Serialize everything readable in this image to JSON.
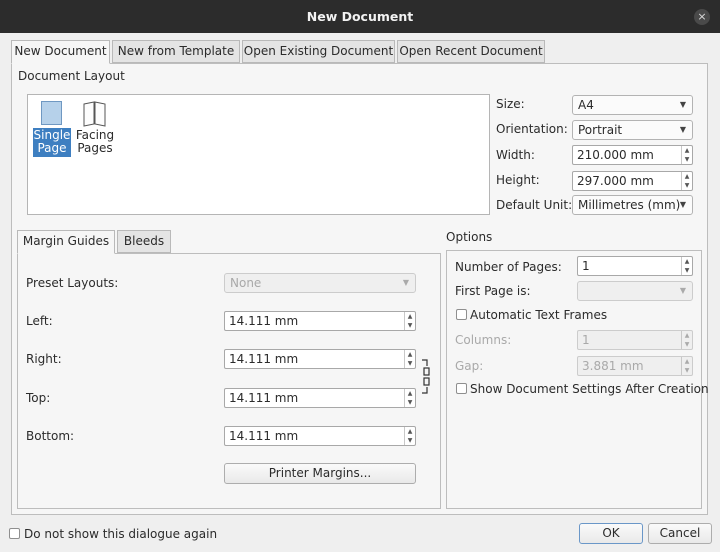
{
  "window": {
    "title": "New Document",
    "close_glyph": "×"
  },
  "tabs": [
    {
      "label": "New Document"
    },
    {
      "label": "New from Template"
    },
    {
      "label": "Open Existing Document"
    },
    {
      "label": "Open Recent Document"
    }
  ],
  "document_layout": {
    "title": "Document Layout",
    "layouts": [
      {
        "line1": "Single",
        "line2": "Page",
        "icon": "single-page-icon"
      },
      {
        "line1": "Facing",
        "line2": "Pages",
        "icon": "facing-pages-icon"
      }
    ],
    "size_label": "Size:",
    "size_value": "A4",
    "orientation_label": "Orientation:",
    "orientation_value": "Portrait",
    "width_label": "Width:",
    "width_value": "210.000 mm",
    "height_label": "Height:",
    "height_value": "297.000 mm",
    "unit_label": "Default Unit:",
    "unit_value": "Millimetres (mm)"
  },
  "margin_tabs": [
    {
      "label": "Margin Guides"
    },
    {
      "label": "Bleeds"
    }
  ],
  "margins": {
    "preset_label": "Preset Layouts:",
    "preset_value": "None",
    "left_label": "Left:",
    "left_value": "14.111 mm",
    "right_label": "Right:",
    "right_value": "14.111 mm",
    "top_label": "Top:",
    "top_value": "14.111 mm",
    "bottom_label": "Bottom:",
    "bottom_value": "14.111 mm",
    "printer_margins_label": "Printer Margins..."
  },
  "options": {
    "title": "Options",
    "pages_label": "Number of Pages:",
    "pages_value": "1",
    "first_page_label": "First Page is:",
    "first_page_value": "",
    "auto_frames_label": "Automatic Text Frames",
    "columns_label": "Columns:",
    "columns_value": "1",
    "gap_label": "Gap:",
    "gap_value": "3.881 mm",
    "show_settings_label": "Show Document Settings After Creation"
  },
  "footer": {
    "dont_show_label": "Do not show this dialogue again",
    "ok_label": "OK",
    "cancel_label": "Cancel"
  },
  "colors": {
    "selection": "#3e7fc1",
    "titlebar": "#2c2c2c"
  }
}
